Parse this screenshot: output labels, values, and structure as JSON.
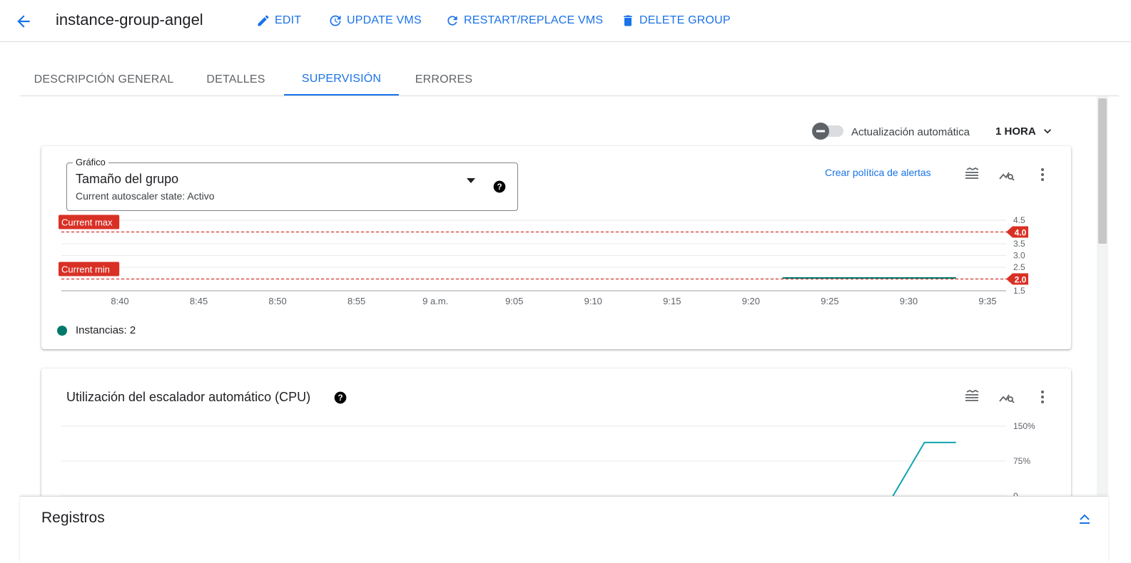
{
  "header": {
    "title": "instance-group-angel",
    "actions": [
      {
        "label": "EDIT",
        "icon": "pencil-icon"
      },
      {
        "label": "UPDATE VMS",
        "icon": "update-icon"
      },
      {
        "label": "RESTART/REPLACE VMS",
        "icon": "refresh-icon"
      },
      {
        "label": "DELETE GROUP",
        "icon": "trash-icon"
      }
    ]
  },
  "tabs": [
    {
      "label": "DESCRIPCIÓN GENERAL",
      "active": false
    },
    {
      "label": "DETALLES",
      "active": false
    },
    {
      "label": "SUPERVISIÓN",
      "active": true
    },
    {
      "label": "ERRORES",
      "active": false
    }
  ],
  "toolbar": {
    "auto_refresh_label": "Actualización automática",
    "auto_refresh_on": false,
    "range_label": "1 HORA"
  },
  "card1": {
    "select_legend": "Gráfico",
    "select_value": "Tamaño del grupo",
    "select_sub": "Current autoscaler state: Activo",
    "alert_link": "Crear política de alertas",
    "legend_label": "Instancias: 2"
  },
  "card2": {
    "title": "Utilización del escalador automático (CPU)"
  },
  "bottom_panel": {
    "title": "Registros"
  },
  "colors": {
    "accent": "#1a73e8",
    "threshold": "#d93025",
    "series_group": "#00796b",
    "series_cpu": "#12a4af"
  },
  "chart_data": [
    {
      "type": "line",
      "x_ticks": [
        "8:40",
        "8:45",
        "8:50",
        "8:55",
        "9 a.m.",
        "9:05",
        "9:10",
        "9:15",
        "9:20",
        "9:25",
        "9:30",
        "9:35"
      ],
      "y_ticks": [
        "4.5",
        "4.0",
        "3.5",
        "3.0",
        "2.5",
        "2.0",
        "1.5"
      ],
      "ylim": [
        1.5,
        4.5
      ],
      "thresholds": [
        {
          "name": "Current max",
          "value": 4.0,
          "label": "4.0"
        },
        {
          "name": "Current min",
          "value": 2.0,
          "label": "2.0"
        }
      ],
      "series": [
        {
          "name": "Instancias",
          "x": [
            "9:22",
            "9:33"
          ],
          "values": [
            2,
            2
          ]
        }
      ]
    },
    {
      "type": "line",
      "y_ticks": [
        "150%",
        "75%",
        "0"
      ],
      "ylim": [
        0,
        150
      ],
      "series": [
        {
          "x": [
            "9:29",
            "9:31",
            "9:33"
          ],
          "values": [
            0,
            115,
            115
          ]
        }
      ]
    }
  ]
}
